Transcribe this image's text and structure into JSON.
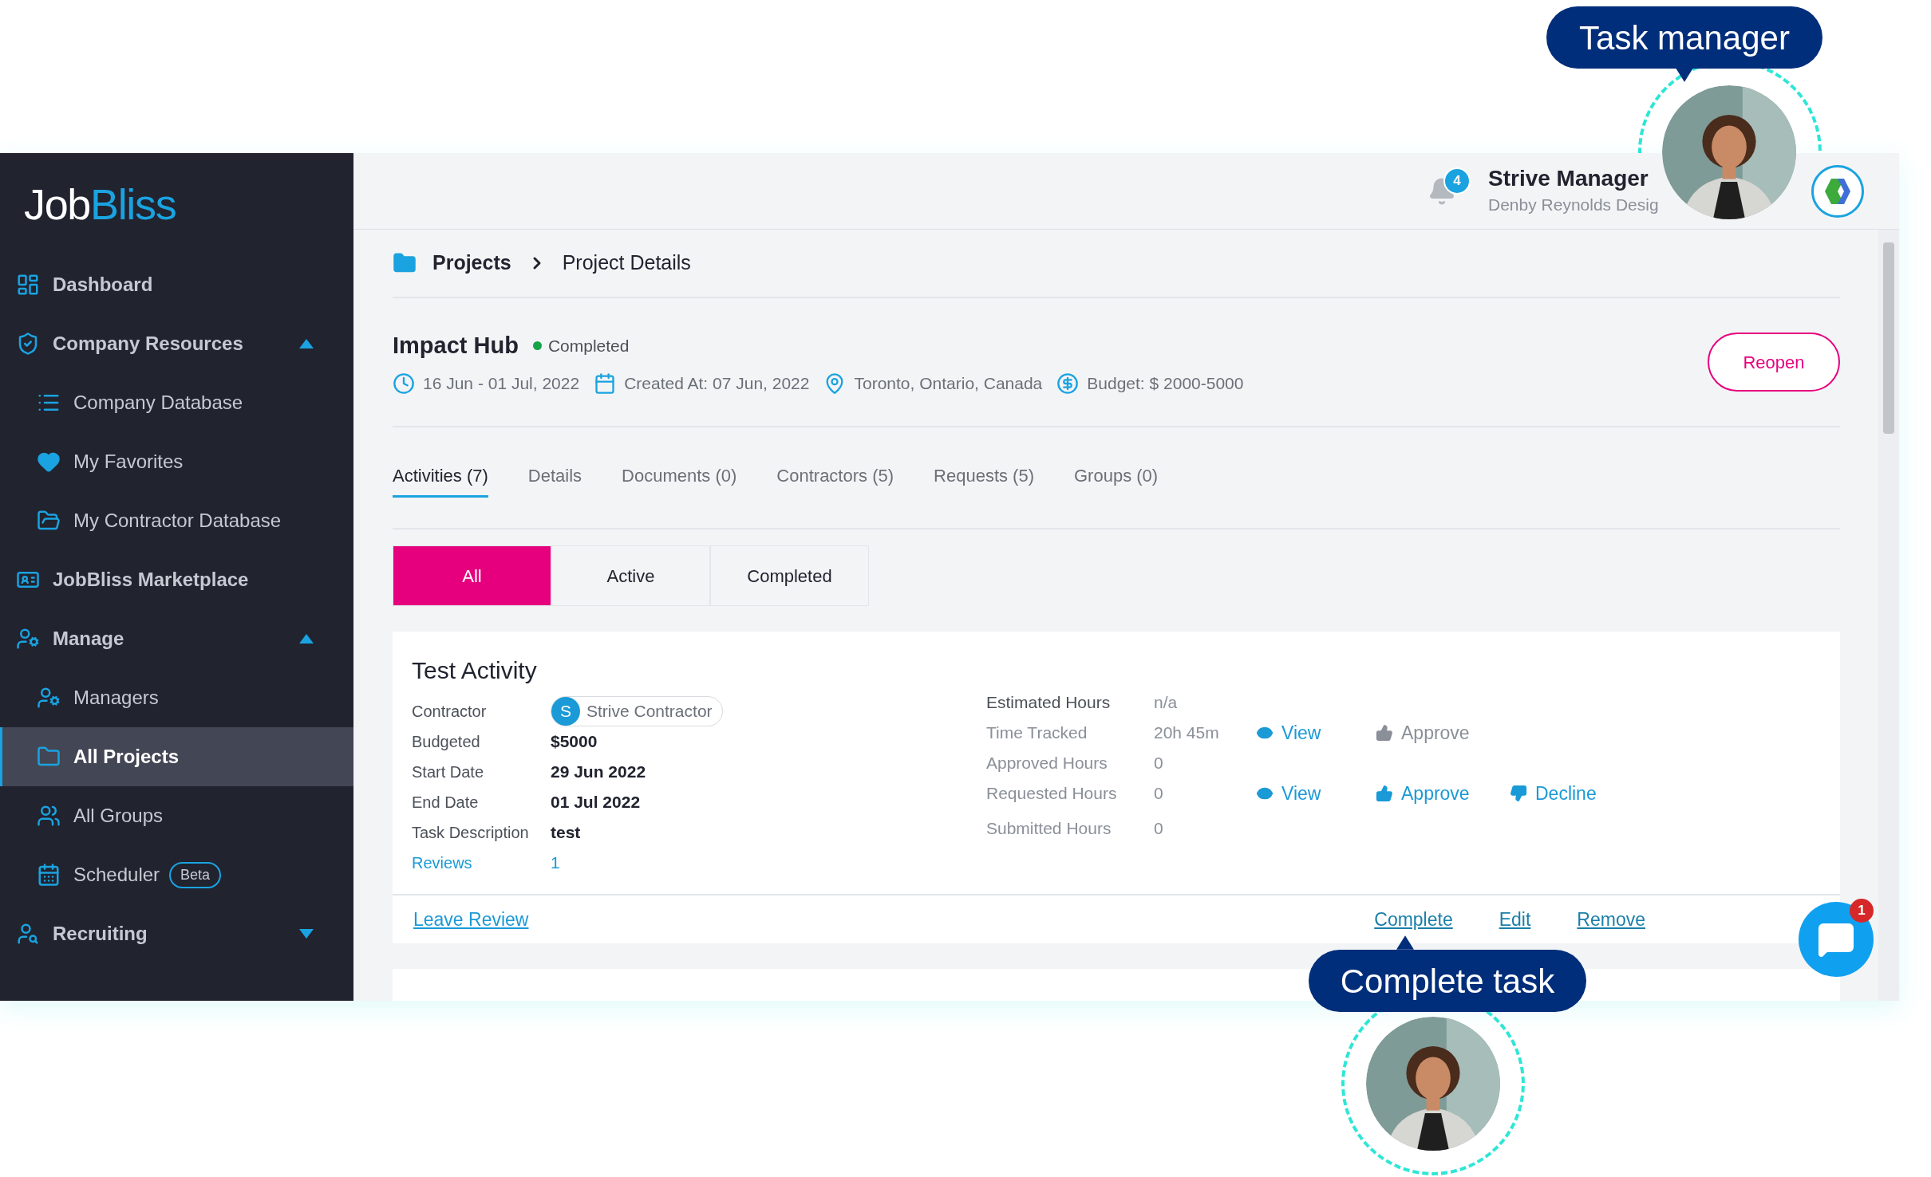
{
  "logo": {
    "part_1": "Job",
    "part_2": "Bliss"
  },
  "sidebar": {
    "items": [
      {
        "label": "Dashboard",
        "selected": false
      },
      {
        "label": "Company Resources",
        "selected": false,
        "expanded": true,
        "children": [
          {
            "label": "Company Database",
            "selected": false
          },
          {
            "label": "My Favorites",
            "selected": false
          },
          {
            "label": "My Contractor Database",
            "selected": false
          }
        ]
      },
      {
        "label": "JobBliss Marketplace",
        "selected": false
      },
      {
        "label": "Manage",
        "selected": false,
        "expanded": true,
        "children": [
          {
            "label": "Managers",
            "selected": false
          },
          {
            "label": "All Projects",
            "selected": true
          },
          {
            "label": "All Groups",
            "selected": false
          },
          {
            "label": "Scheduler",
            "selected": false,
            "badge": "Beta"
          }
        ]
      },
      {
        "label": "Recruiting",
        "selected": false,
        "expanded": false
      }
    ]
  },
  "header": {
    "notification_count": "4",
    "user_name": "Strive Manager",
    "company": "Denby Reynolds Desig"
  },
  "breadcrumb": [
    "Projects",
    "Project Details"
  ],
  "project": {
    "title": "Impact Hub",
    "status": {
      "label": "Completed",
      "color": "#16a34a"
    },
    "meta": [
      {
        "kind": "clock",
        "text": "16 Jun - 01 Jul, 2022"
      },
      {
        "kind": "calendar",
        "text": "Created At: 07 Jun, 2022"
      },
      {
        "kind": "pin",
        "text": "Toronto, Ontario, Canada"
      },
      {
        "kind": "dollar",
        "text": "Budget: $ 2000-5000"
      }
    ],
    "action": "Reopen"
  },
  "tabs": [
    {
      "label": "Activities (7)",
      "selected": true
    },
    {
      "label": "Details",
      "selected": false
    },
    {
      "label": "Documents (0)",
      "selected": false
    },
    {
      "label": "Contractors (5)",
      "selected": false
    },
    {
      "label": "Requests (5)",
      "selected": false
    },
    {
      "label": "Groups (0)",
      "selected": false
    }
  ],
  "filters": [
    {
      "label": "All",
      "selected": true
    },
    {
      "label": "Active",
      "selected": false
    },
    {
      "label": "Completed",
      "selected": false
    }
  ],
  "activity": {
    "title": "Test Activity",
    "fields": [
      {
        "kind": "chip",
        "label": "Contractor",
        "avatar": "S",
        "value": "Strive Contractor"
      },
      {
        "kind": "text",
        "label": "Budgeted",
        "value": "$5000"
      },
      {
        "kind": "text",
        "label": "Start Date",
        "value": "29 Jun 2022"
      },
      {
        "kind": "text",
        "label": "End Date",
        "value": "01 Jul 2022"
      },
      {
        "kind": "text",
        "label": "Task Description",
        "value": "test"
      },
      {
        "kind": "link",
        "label": "Reviews",
        "value": "1"
      }
    ],
    "hours": [
      {
        "label": "Estimated Hours",
        "value": "n/a"
      },
      {
        "label": "Time Tracked",
        "value": "20h 45m",
        "actions": [
          {
            "kind": "view",
            "label": "View",
            "disabled": false
          },
          {
            "kind": "approve",
            "label": "Approve",
            "disabled": true
          }
        ]
      },
      {
        "label": "Approved Hours",
        "value": "0"
      },
      {
        "label": "Requested Hours",
        "value": "0",
        "actions": [
          {
            "kind": "view",
            "label": "View",
            "disabled": false
          },
          {
            "kind": "approve",
            "label": "Approve",
            "disabled": false
          },
          {
            "kind": "decline",
            "label": "Decline",
            "disabled": false
          }
        ]
      },
      {
        "label": "Submitted Hours",
        "value": "0"
      }
    ],
    "review_link": "Leave Review",
    "links": [
      "Complete",
      "Edit",
      "Remove"
    ]
  },
  "chat": {
    "badge": "1"
  },
  "callouts": [
    {
      "text": "Task manager"
    },
    {
      "text": "Complete task"
    }
  ]
}
